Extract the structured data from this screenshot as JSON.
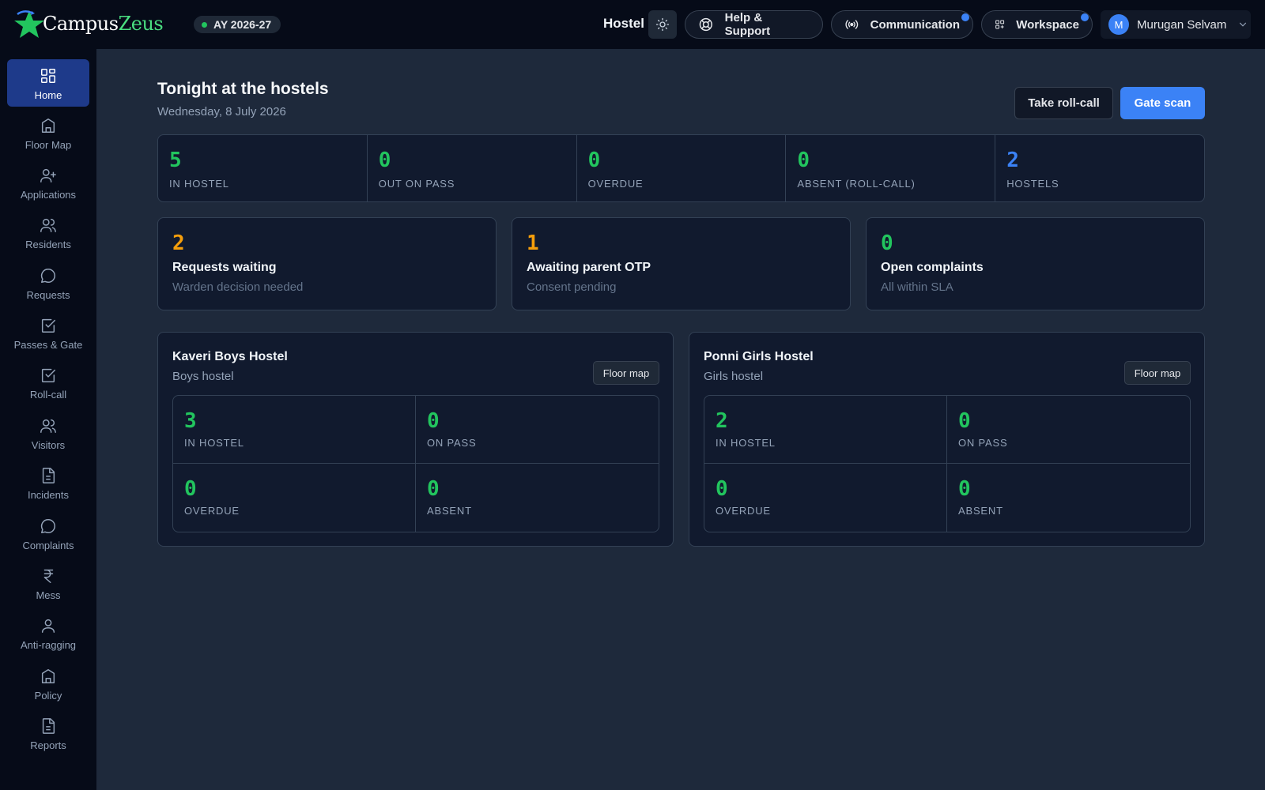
{
  "brand": {
    "part1": "Campus",
    "part2": "Zeus"
  },
  "header": {
    "academic_year": "AY 2026-27",
    "module": "Hostel",
    "help_label": "Help & Support",
    "communication_label": "Communication",
    "workspace_label": "Workspace",
    "user_initial": "M",
    "user_name": "Murugan Selvam"
  },
  "sidebar": {
    "items": [
      {
        "label": "Home",
        "icon": "grid-icon"
      },
      {
        "label": "Floor Map",
        "icon": "building-icon"
      },
      {
        "label": "Applications",
        "icon": "user-plus-icon"
      },
      {
        "label": "Residents",
        "icon": "users-icon"
      },
      {
        "label": "Requests",
        "icon": "chat-bubble-icon"
      },
      {
        "label": "Passes & Gate",
        "icon": "check-square-icon"
      },
      {
        "label": "Roll-call",
        "icon": "check-square-icon"
      },
      {
        "label": "Visitors",
        "icon": "users-icon"
      },
      {
        "label": "Incidents",
        "icon": "document-icon"
      },
      {
        "label": "Complaints",
        "icon": "chat-bubble-icon"
      },
      {
        "label": "Mess",
        "icon": "rupee-icon"
      },
      {
        "label": "Anti-ragging",
        "icon": "user-icon"
      },
      {
        "label": "Policy",
        "icon": "building-icon"
      },
      {
        "label": "Reports",
        "icon": "document-icon"
      }
    ]
  },
  "main": {
    "title": "Tonight at the hostels",
    "date": "Wednesday, 8 July 2026",
    "roll_call_button": "Take roll-call",
    "gate_scan_button": "Gate scan",
    "stats": [
      {
        "value": "5",
        "label": "IN HOSTEL",
        "color": "#22c55e"
      },
      {
        "value": "0",
        "label": "OUT ON PASS",
        "color": "#22c55e"
      },
      {
        "value": "0",
        "label": "OVERDUE",
        "color": "#22c55e"
      },
      {
        "value": "0",
        "label": "ABSENT (ROLL-CALL)",
        "color": "#22c55e"
      },
      {
        "value": "2",
        "label": "HOSTELS",
        "color": "#3b82f6"
      }
    ],
    "alerts": [
      {
        "value": "2",
        "title": "Requests waiting",
        "subtitle": "Warden decision needed",
        "color": "#f59e0b"
      },
      {
        "value": "1",
        "title": "Awaiting parent OTP",
        "subtitle": "Consent pending",
        "color": "#f59e0b"
      },
      {
        "value": "0",
        "title": "Open complaints",
        "subtitle": "All within SLA",
        "color": "#22c55e"
      }
    ],
    "hostels": [
      {
        "name": "Kaveri Boys Hostel",
        "type": "Boys hostel",
        "floor_map_label": "Floor map",
        "metrics": [
          {
            "value": "3",
            "label": "IN HOSTEL"
          },
          {
            "value": "0",
            "label": "ON PASS"
          },
          {
            "value": "0",
            "label": "OVERDUE"
          },
          {
            "value": "0",
            "label": "ABSENT"
          }
        ]
      },
      {
        "name": "Ponni Girls Hostel",
        "type": "Girls hostel",
        "floor_map_label": "Floor map",
        "metrics": [
          {
            "value": "2",
            "label": "IN HOSTEL"
          },
          {
            "value": "0",
            "label": "ON PASS"
          },
          {
            "value": "0",
            "label": "OVERDUE"
          },
          {
            "value": "0",
            "label": "ABSENT"
          }
        ]
      }
    ]
  }
}
